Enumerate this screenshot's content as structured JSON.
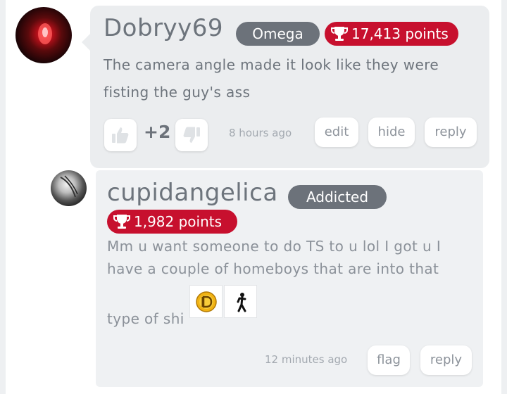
{
  "comments": [
    {
      "username": "Dobryy69",
      "rank": "Omega",
      "points": "17,413 points",
      "text_line1": "The camera angle made it look like they were",
      "text_line2": "fisting the guy's ass",
      "votes": "+2",
      "timestamp": "8 hours ago",
      "actions": [
        "edit",
        "hide",
        "reply"
      ]
    },
    {
      "username": "cupidangelica",
      "rank": "Addicted",
      "points": "1,982 points",
      "text_line1": "Mm u want someone to do TS to u lol I got u I",
      "text_line2": "have a couple of homeboys that are into that",
      "text_line3": "type of shi",
      "emojis": [
        "coin-d-icon",
        "stick-figure-icon"
      ],
      "timestamp": "12 minutes ago",
      "actions": [
        "flag",
        "reply"
      ]
    }
  ],
  "icons": {
    "trophy": "trophy-icon",
    "upvote": "thumbs-up-icon",
    "downvote": "thumbs-down-icon"
  },
  "colors": {
    "points_badge": "#c7102e",
    "rank_badge": "#6c727a",
    "bubble": "#ebedef"
  }
}
